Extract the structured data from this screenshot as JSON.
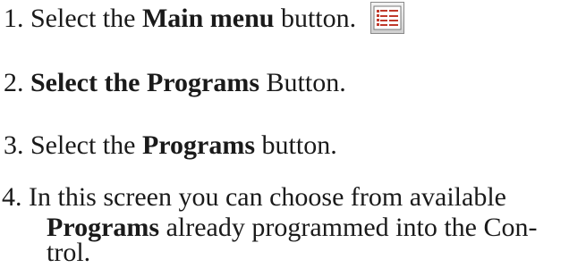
{
  "steps": [
    {
      "prefix": "1. Select the ",
      "bold": "Main menu",
      "suffix": " button.",
      "icon": "main-menu-icon"
    },
    {
      "prefix": "2. ",
      "bold": "Select the Programs",
      "suffix": " Button."
    },
    {
      "prefix": "3. Select the ",
      "bold": "Programs",
      "suffix": " button."
    },
    {
      "line1": "4. In this screen you can choose from available",
      "bold": "Programs",
      "line2_suffix": " already programmed into the Con-",
      "line3": "trol."
    }
  ],
  "colors": {
    "icon_accent": "#c0392b",
    "text": "#1a1a1a"
  }
}
